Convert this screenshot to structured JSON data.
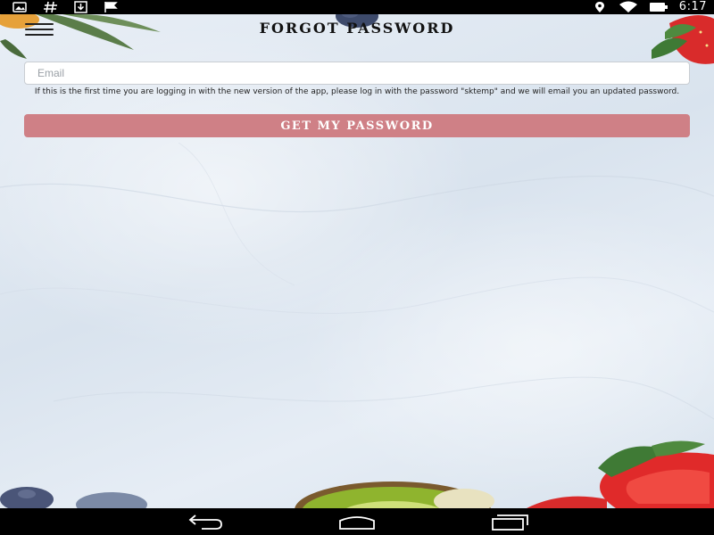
{
  "status_bar": {
    "time": "6:17",
    "left_icons": [
      "gallery-icon",
      "hash-icon",
      "download-icon",
      "flag-icon"
    ],
    "right_icons": [
      "location-icon",
      "wifi-icon",
      "battery-icon"
    ]
  },
  "header": {
    "title": "FORGOT PASSWORD",
    "menu_icon": "hamburger-menu-icon"
  },
  "form": {
    "email_placeholder": "Email",
    "email_value": "",
    "helper_text": "If this is the first time you are logging in with the new version of the app, please log in with the password \"sktemp\" and we will email you an updated password.",
    "submit_label": "GET MY PASSWORD"
  },
  "nav_bar": {
    "buttons": [
      "back-icon",
      "home-icon",
      "recent-apps-icon"
    ]
  },
  "colors": {
    "accent_button": "#cf8086",
    "status_bar": "#000000",
    "title_text": "#111111"
  }
}
